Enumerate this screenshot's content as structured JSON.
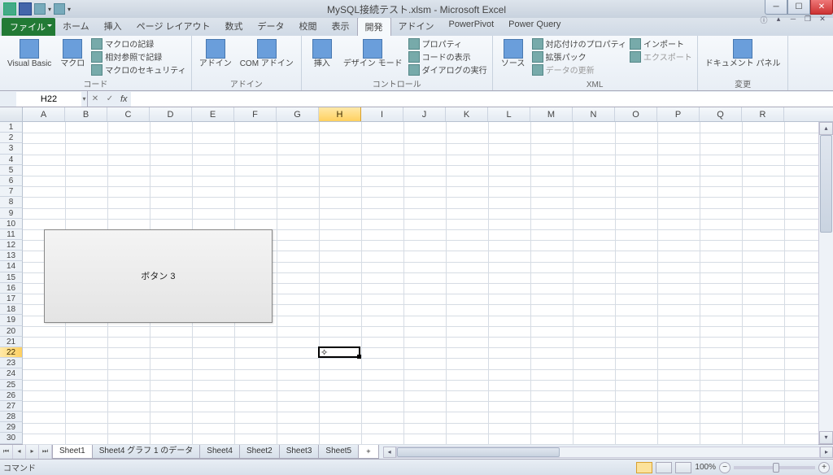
{
  "title": "MySQL接続テスト.xlsm - Microsoft Excel",
  "tabs": {
    "file": "ファイル",
    "list": [
      "ホーム",
      "挿入",
      "ページ レイアウト",
      "数式",
      "データ",
      "校閲",
      "表示",
      "開発",
      "アドイン",
      "PowerPivot",
      "Power Query"
    ],
    "active": "開発"
  },
  "ribbon": {
    "g1": {
      "label": "コード",
      "vb": "Visual Basic",
      "macro": "マクロ",
      "rec": "マクロの記録",
      "rel": "相対参照で記録",
      "sec": "マクロのセキュリティ"
    },
    "g2": {
      "label": "アドイン",
      "addin": "アドイン",
      "com": "COM\nアドイン"
    },
    "g3": {
      "label": "コントロール",
      "insert": "挿入",
      "design": "デザイン\nモード",
      "prop": "プロパティ",
      "code": "コードの表示",
      "dialog": "ダイアログの実行"
    },
    "g4": {
      "label": "XML",
      "source": "ソース",
      "map": "対応付けのプロパティ",
      "exp": "拡張パック",
      "refresh": "データの更新",
      "import": "インポート",
      "export": "エクスポート"
    },
    "g5": {
      "label": "変更",
      "docpanel": "ドキュメント\nパネル"
    }
  },
  "namebox": "H22",
  "columns": [
    "A",
    "B",
    "C",
    "D",
    "E",
    "F",
    "G",
    "H",
    "I",
    "J",
    "K",
    "L",
    "M",
    "N",
    "O",
    "P",
    "Q",
    "R"
  ],
  "selected_col": "H",
  "rows": 30,
  "selected_row": 22,
  "button_label": "ボタン 3",
  "sheets": [
    "Sheet1",
    "Sheet4 グラフ 1 のデータ",
    "Sheet4",
    "Sheet2",
    "Sheet3",
    "Sheet5"
  ],
  "status_left": "コマンド",
  "zoom": "100%"
}
